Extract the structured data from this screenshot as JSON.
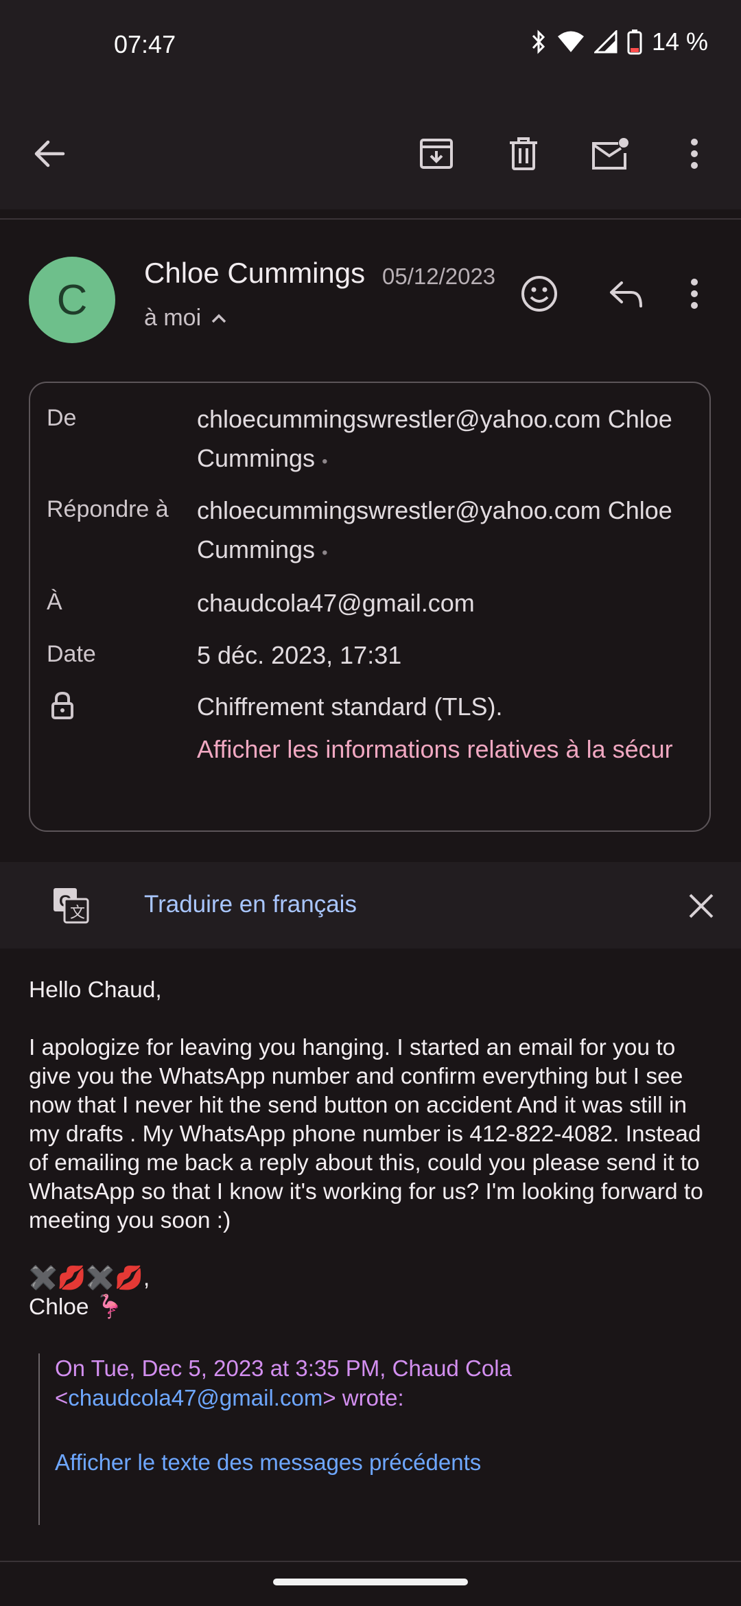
{
  "status_bar": {
    "time": "07:47",
    "battery": "14 %"
  },
  "sender": {
    "initial": "C",
    "name": "Chloe Cummings",
    "date": "05/12/2023",
    "to_me": "à moi"
  },
  "details": {
    "from_label": "De",
    "from_value": "chloecummingswrestler@yahoo.com Chloe Cummings",
    "reply_label": "Répondre à",
    "reply_value": "chloecummingswrestler@yahoo.com Chloe Cummings",
    "to_label": "À",
    "to_value": "chaudcola47@gmail.com",
    "date_label": "Date",
    "date_value": "5 déc. 2023, 17:31",
    "encryption": "Chiffrement standard (TLS).",
    "security_link": "Afficher les informations relatives à la sécur"
  },
  "translate": {
    "label": "Traduire en français"
  },
  "body": {
    "greeting": "Hello Chaud,",
    "paragraph": "I apologize for leaving you hanging. I started an email for you to give you the WhatsApp number and confirm everything but I see now that I never hit the send button on accident And it was still in my drafts . My WhatsApp phone number is 412-822-4082. Instead of emailing me back a reply about this, could you please send it to WhatsApp so that I know it's working for us? I'm looking forward to meeting you soon :)",
    "signoff_emoji": "✖️💋✖️💋,",
    "signature": "Chloe 🦩"
  },
  "quote": {
    "attribution_prefix": "On Tue, Dec 5, 2023 at 3:35 PM, Chaud Cola <",
    "attribution_email": "chaudcola47@gmail.com",
    "attribution_suffix": "> wrote:",
    "show_previous": "Afficher le texte des messages précédents"
  }
}
